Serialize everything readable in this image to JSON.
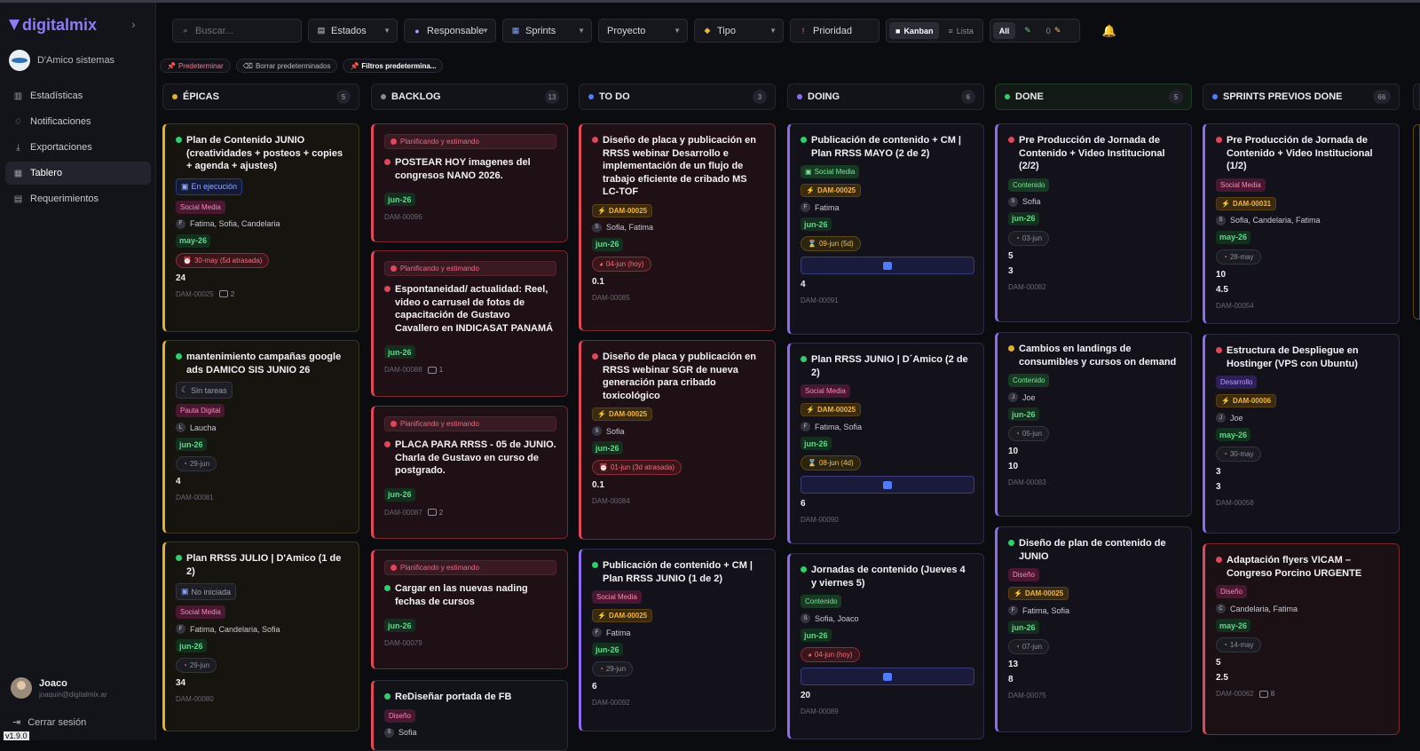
{
  "app": {
    "brand": "digitalmix",
    "org": "D'Amico sistemas",
    "version": "v1.9.0"
  },
  "sidebar": {
    "items": [
      {
        "label": "Estadísticas",
        "icon": "bar-chart-icon"
      },
      {
        "label": "Notificaciones",
        "icon": "bell-icon"
      },
      {
        "label": "Exportaciones",
        "icon": "download-icon"
      },
      {
        "label": "Tablero",
        "icon": "grid-icon",
        "active": true
      },
      {
        "label": "Requerimientos",
        "icon": "document-icon"
      }
    ],
    "user": {
      "name": "Joaco",
      "email": "joaquin@digitalmix.ar"
    },
    "logout": "Cerrar sesión"
  },
  "toolbar": {
    "search_placeholder": "Buscar...",
    "filters": [
      "Estados",
      "Responsable",
      "Sprints",
      "Proyecto",
      "Tipo",
      "Prioridad"
    ],
    "view_kanban": "Kanban",
    "view_list": "Lista",
    "all": "All",
    "zero": "0"
  },
  "preset": {
    "set": "Predeterminar",
    "clear": "Borrar predeterminados",
    "saved": "Filtros predetermina..."
  },
  "columns": [
    {
      "title": "ÉPICAS",
      "count": "5",
      "color": "#e0b12b"
    },
    {
      "title": "BACKLOG",
      "count": "13",
      "color": "#8a8b96"
    },
    {
      "title": "TO DO",
      "count": "3",
      "color": "#4f7cff"
    },
    {
      "title": "DOING",
      "count": "6",
      "color": "#8e6cf0"
    },
    {
      "title": "DONE",
      "count": "5",
      "color": "#2fcf6b"
    },
    {
      "title": "SPRINTS PREVIOS DONE",
      "count": "66",
      "color": "#4f7cff"
    }
  ],
  "cards": {
    "e1": {
      "title": "Plan de Contenido JUNIO (creatividades + posteos + copies + agenda + ajustes)",
      "state": "En ejecución",
      "tag": "Social Media",
      "people": "Fatima, Sofia, Candelaria",
      "sprint": "may-26",
      "due": "30-may (5d atrasada)",
      "num": "24",
      "code": "DAM-00025",
      "comments": "2"
    },
    "e2": {
      "title": "mantenimiento campañas google ads DAMICO SIS JUNIO 26",
      "state": "Sin tareas",
      "tag": "Pauta Digital",
      "people": "Laucha",
      "sprint": "jun-26",
      "due": "29-jun",
      "num": "4",
      "code": "DAM-00081"
    },
    "e3": {
      "title": "Plan RRSS JULIO | D'Amico (1 de 2)",
      "state": "No iniciada",
      "tag": "Social Media",
      "people": "Fatima, Candelaria, Sofia",
      "sprint": "jun-26",
      "due": "29-jun",
      "num": "34",
      "code": "DAM-00080"
    },
    "b1": {
      "status": "Planificando y estimando",
      "title": "POSTEAR HOY imagenes del congresos NANO 2026.",
      "sprint": "jun-26",
      "code": "DAM-00096"
    },
    "b2": {
      "status": "Planificando y estimando",
      "title": "Espontaneidad/ actualidad: Reel, video o carrusel de fotos de capacitación de Gustavo Cavallero en INDICASAT PANAMÁ",
      "sprint": "jun-26",
      "code": "DAM-00088",
      "comments": "1"
    },
    "b3": {
      "status": "Planificando y estimando",
      "title": "PLACA PARA RRSS - 05 de JUNIO. Charla de Gustavo en curso de postgrado.",
      "sprint": "jun-26",
      "code": "DAM-00087",
      "comments": "2"
    },
    "b4": {
      "status": "Planificando y estimando",
      "title": "Cargar en las nuevas nading fechas de cursos",
      "sprint": "jun-26",
      "code": "DAM-00079"
    },
    "b5": {
      "title": "ReDiseñar portada de FB",
      "tag": "Diseño",
      "people": "Sofia"
    },
    "t1": {
      "title": "Diseño de placa y publicación en RRSS webinar Desarrollo e implementación de un flujo de trabajo eficiente de cribado MS LC-TOF",
      "dam": "DAM-00025",
      "people": "Sofia, Fatima",
      "sprint": "jun-26",
      "due": "04-jun (hoy)",
      "num": "0.1",
      "code": "DAM-00085"
    },
    "t2": {
      "title": "Diseño de placa y publicación en RRSS webinar SGR de nueva generación para cribado toxicológico",
      "dam": "DAM-00025",
      "people": "Sofia",
      "sprint": "jun-26",
      "due": "01-jun (3d atrasada)",
      "num": "0.1",
      "code": "DAM-00084"
    },
    "t3": {
      "title": "Publicación de contenido + CM | Plan RRSS JUNIO (1 de 2)",
      "tag": "Social Media",
      "dam": "DAM-00025",
      "people": "Fatima",
      "sprint": "jun-26",
      "due": "29-jun",
      "num": "6",
      "code": "DAM-00092"
    },
    "d1": {
      "title": "Publicación de contenido + CM | Plan RRSS MAYO (2 de 2)",
      "tag": "Social Media",
      "dam": "DAM-00025",
      "people": "Fatima",
      "sprint": "jun-26",
      "due": "09-jun (5d)",
      "num": "4",
      "code": "DAM-00091"
    },
    "d2": {
      "title": "Plan RRSS JUNIO | D´Amico (2 de 2)",
      "tag": "Social Media",
      "dam": "DAM-00025",
      "people": "Fatima, Sofia",
      "sprint": "jun-26",
      "due": "08-jun (4d)",
      "num": "6",
      "code": "DAM-00090"
    },
    "d3": {
      "title": "Jornadas de contenido (Jueves 4 y viernes 5)",
      "tag": "Contenido",
      "people": "Sofia, Joaco",
      "sprint": "jun-26",
      "due": "04-jun (hoy)",
      "num": "20",
      "code": "DAM-00089"
    },
    "n1": {
      "title": "Pre Producción de Jornada de Contenido + Video Institucional (2/2)",
      "tag": "Contenido",
      "people": "Sofia",
      "sprint": "jun-26",
      "due": "03-jun",
      "num1": "5",
      "num2": "3",
      "code": "DAM-00082"
    },
    "n2": {
      "title": "Cambios en landings de consumibles y cursos on demand",
      "tag": "Contenido",
      "people": "Joe",
      "sprint": "jun-26",
      "due": "05-jun",
      "num1": "10",
      "num2": "10",
      "code": "DAM-00083"
    },
    "n3": {
      "title": "Diseño de plan de contenido de JUNIO",
      "tag": "Diseño",
      "dam": "DAM-00025",
      "people": "Fatima, Sofia",
      "sprint": "jun-26",
      "due": "07-jun",
      "num1": "13",
      "num2": "8",
      "code": "DAM-00075"
    },
    "p1": {
      "title": "Pre Producción de Jornada de Contenido + Video Institucional (1/2)",
      "tag": "Social Media",
      "dam": "DAM-00031",
      "people": "Sofia, Candelaria, Fatima",
      "sprint": "may-26",
      "due": "28-may",
      "num1": "10",
      "num2": "4.5",
      "code": "DAM-00054"
    },
    "p2": {
      "title": "Estructura de Despliegue en Hostinger (VPS con Ubuntu)",
      "tag": "Desarrollo",
      "dam": "DAM-00006",
      "people": "Joe",
      "sprint": "may-26",
      "due": "30-may",
      "num1": "3",
      "num2": "3",
      "code": "DAM-00058"
    },
    "p3": {
      "title": "Adaptación flyers VICAM – Congreso Porcino URGENTE",
      "tag": "Diseño",
      "people": "Candelaria, Fatima",
      "sprint": "may-26",
      "due": "14-may",
      "num1": "5",
      "num2": "2.5",
      "code": "DAM-00062",
      "comments": "8"
    }
  }
}
